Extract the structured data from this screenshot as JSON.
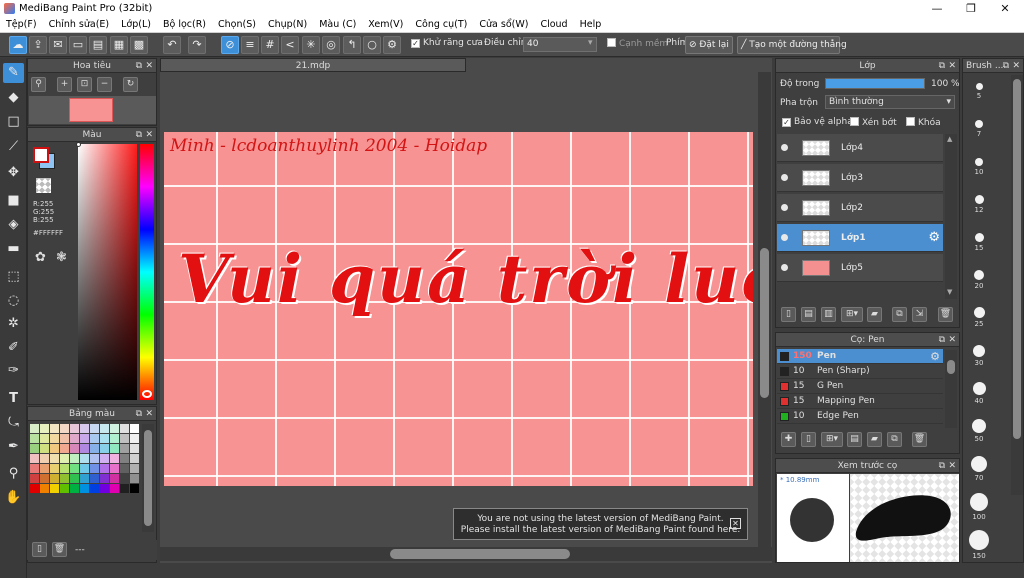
{
  "window": {
    "title": "MediBang Paint Pro (32bit)",
    "min": "—",
    "max": "❐",
    "close": "✕"
  },
  "menu": [
    "Tệp(F)",
    "Chỉnh sửa(E)",
    "Lớp(L)",
    "Bộ lọc(R)",
    "Chọn(S)",
    "Chụp(N)",
    "Màu (C)",
    "Xem(V)",
    "Công cụ(T)",
    "Cửa sổ(W)",
    "Cloud",
    "Help"
  ],
  "toolbar": {
    "antialias_label": "Khử răng cưa",
    "adjust_label": "Điều chỉnh",
    "adjust_value": "40",
    "edge_label": "Cạnh mềm",
    "key_label": "Phím",
    "reset_label": "Đặt lại",
    "straight_label": "Tạo một đường thẳng"
  },
  "navigator": {
    "title": "Hoa tiêu"
  },
  "color_panel": {
    "title": "Màu",
    "r": "R:255",
    "g": "G:255",
    "b": "B:255",
    "hex": "#FFFFFF",
    "fg_color": "#ffffff",
    "bg_color": "#8fc4f2"
  },
  "palette": {
    "title": "Bảng màu",
    "footer": "---",
    "colors": [
      "#d8ecc8",
      "#e8f0c0",
      "#f3e6c4",
      "#f3d8c8",
      "#e8c8d8",
      "#d8c8ec",
      "#c8d8f0",
      "#c8e8f0",
      "#d0f0e0",
      "#e0e0e0",
      "#ffffff",
      "#b8e0a0",
      "#e0e8a0",
      "#f0d8a0",
      "#f0c0a8",
      "#e0a8c8",
      "#c8a8e8",
      "#a8c8f0",
      "#a8e0f0",
      "#b0f0d0",
      "#c0c0c0",
      "#f0f0f0",
      "#98d080",
      "#d0e080",
      "#f0c880",
      "#f0a890",
      "#d888b8",
      "#b088e0",
      "#88b0e8",
      "#88d0e8",
      "#90e8c0",
      "#a0a0a0",
      "#e0e0e0",
      "#f0c0c0",
      "#f0d0b0",
      "#f0e0b0",
      "#e0f0b0",
      "#c0f0c0",
      "#b0e0f0",
      "#b0c0f0",
      "#d0b0f0",
      "#f0b0e0",
      "#808080",
      "#d0d0d0",
      "#e87878",
      "#e8a070",
      "#e8d070",
      "#b8e070",
      "#70e080",
      "#70c8e8",
      "#7090e8",
      "#b070e8",
      "#e870c8",
      "#606060",
      "#b0b0b0",
      "#d04040",
      "#d07030",
      "#d0b030",
      "#90c030",
      "#30c050",
      "#30a0d0",
      "#3060d0",
      "#8030d0",
      "#d030a0",
      "#404040",
      "#909090",
      "#e00000",
      "#f08000",
      "#f0d000",
      "#60c000",
      "#00b040",
      "#0090e0",
      "#0040e0",
      "#7000e0",
      "#e000b0",
      "#202020",
      "#000000"
    ]
  },
  "document": {
    "tab": "21.mdp",
    "signature": "Minh - lcdoanthuylinh 2004 - Hoidap",
    "headline": "Vui quá trời luôn"
  },
  "notice": {
    "line1": "You are not using the latest version of MediBang Paint.",
    "line2": "Please install the latest version of MediBang Paint found here.",
    "close": "✕"
  },
  "layers_panel": {
    "title": "Lớp",
    "opacity_label": "Độ trong",
    "opacity_value": 100,
    "opacity_text": "100 %",
    "blend_label": "Pha trộn",
    "blend_value": "Bình thường",
    "alpha_lock": "Bảo vệ alpha",
    "clipping": "Xén bớt",
    "lock": "Khóa",
    "layers": [
      {
        "name": "Lớp4",
        "selected": false
      },
      {
        "name": "Lớp3",
        "selected": false
      },
      {
        "name": "Lớp2",
        "selected": false
      },
      {
        "name": "Lớp1",
        "selected": true
      },
      {
        "name": "Lớp5",
        "selected": false
      }
    ]
  },
  "brush_panel": {
    "title": "Cọ: Pen",
    "brushes": [
      {
        "size": "150",
        "name": "Pen",
        "color": "#222222",
        "selected": true
      },
      {
        "size": "10",
        "name": "Pen (Sharp)",
        "color": "#222222",
        "selected": false
      },
      {
        "size": "15",
        "name": "G Pen",
        "color": "#e03030",
        "selected": false
      },
      {
        "size": "15",
        "name": "Mapping Pen",
        "color": "#e03030",
        "selected": false
      },
      {
        "size": "10",
        "name": "Edge Pen",
        "color": "#20b020",
        "selected": false
      }
    ]
  },
  "preview_panel": {
    "title": "Xem trước cọ",
    "size_label": "* 10.89mm"
  },
  "brush_sizes": {
    "title": "Brush ...",
    "sizes": [
      "5",
      "7",
      "10",
      "12",
      "15",
      "20",
      "25",
      "30",
      "40",
      "50",
      "70",
      "100",
      "150"
    ]
  }
}
